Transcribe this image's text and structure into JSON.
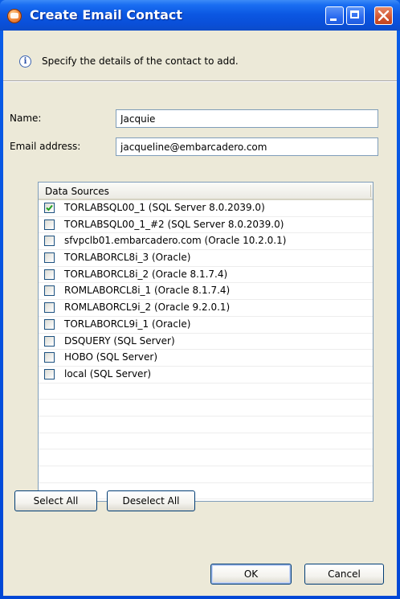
{
  "window": {
    "title": "Create Email Contact"
  },
  "info": {
    "message": "Specify the details of the contact to add."
  },
  "form": {
    "name_label": "Name:",
    "name_value": "Jacquie",
    "email_label": "Email address:",
    "email_value": "jacqueline@embarcadero.com"
  },
  "data_sources": {
    "header": "Data Sources",
    "items": [
      {
        "label": "TORLABSQL00_1 (SQL Server 8.0.2039.0)",
        "checked": true
      },
      {
        "label": "TORLABSQL00_1_#2 (SQL Server 8.0.2039.0)",
        "checked": false
      },
      {
        "label": "sfvpclb01.embarcadero.com (Oracle 10.2.0.1)",
        "checked": false
      },
      {
        "label": "TORLABORCL8i_3 (Oracle)",
        "checked": false
      },
      {
        "label": "TORLABORCL8i_2 (Oracle 8.1.7.4)",
        "checked": false
      },
      {
        "label": "ROMLABORCL8i_1 (Oracle 8.1.7.4)",
        "checked": false
      },
      {
        "label": "ROMLABORCL9i_2 (Oracle 9.2.0.1)",
        "checked": false
      },
      {
        "label": "TORLABORCL9i_1 (Oracle)",
        "checked": false
      },
      {
        "label": "DSQUERY (SQL Server)",
        "checked": false
      },
      {
        "label": "HOBO (SQL Server)",
        "checked": false
      },
      {
        "label": "local (SQL Server)",
        "checked": false
      }
    ]
  },
  "buttons": {
    "select_all": "Select All",
    "deselect_all": "Deselect All",
    "ok": "OK",
    "cancel": "Cancel"
  },
  "colors": {
    "title_bar": "#0a4fd8",
    "dialog_background": "#ece9d8",
    "field_border": "#7f9db9",
    "check_mark": "#21a121"
  }
}
